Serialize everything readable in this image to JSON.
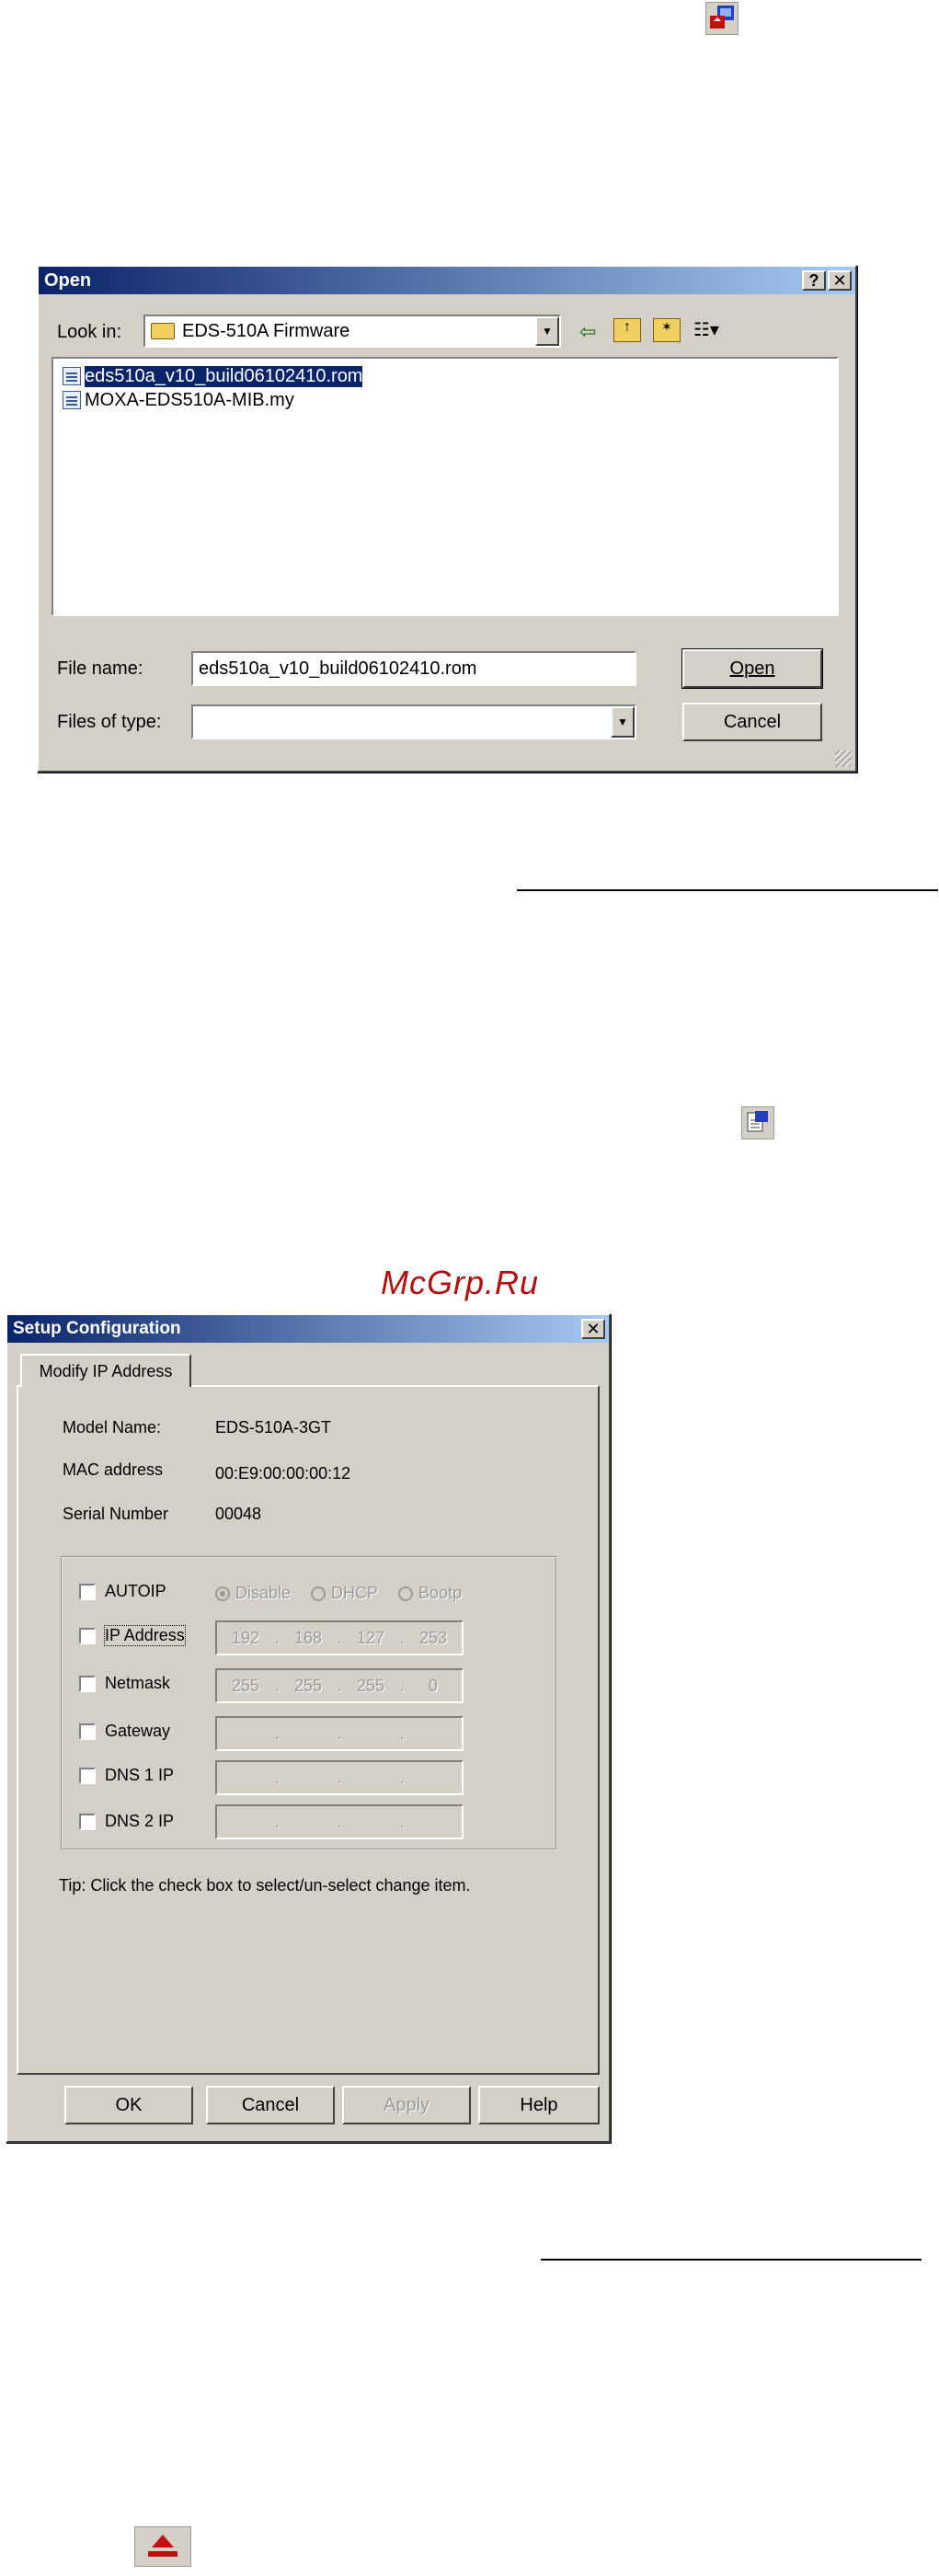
{
  "open_dialog": {
    "title": "Open",
    "help_btn": "?",
    "close_btn": "✕",
    "look_in_label": "Look in:",
    "look_in_value": "EDS-510A Firmware",
    "files": [
      {
        "name": "eds510a_v10_build06102410.rom",
        "selected": true
      },
      {
        "name": "MOXA-EDS510A-MIB.my",
        "selected": false
      }
    ],
    "file_name_label": "File name:",
    "file_name_value": "eds510a_v10_build06102410.rom",
    "files_of_type_label": "Files of type:",
    "files_of_type_value": "",
    "open_button": "Open",
    "cancel_button": "Cancel"
  },
  "watermark": "McGrp.Ru",
  "setup_dialog": {
    "title": "Setup Configuration",
    "close_btn": "✕",
    "tab_label": "Modify IP Address",
    "model_name_label": "Model Name:",
    "model_name_value": "EDS-510A-3GT",
    "mac_label": "MAC address",
    "mac_value": "00:E9:00:00:00:12",
    "serial_label": "Serial Number",
    "serial_value": "00048",
    "autoip_label": "AUTOIP",
    "radio_disable": "Disable",
    "radio_dhcp": "DHCP",
    "radio_bootp": "Bootp",
    "ip_label": "IP Address",
    "ip_octets": [
      "192",
      "168",
      "127",
      "253"
    ],
    "netmask_label": "Netmask",
    "netmask_octets": [
      "255",
      "255",
      "255",
      "0"
    ],
    "gateway_label": "Gateway",
    "dns1_label": "DNS 1 IP",
    "dns2_label": "DNS 2 IP",
    "tip": "Tip: Click the check box to select/un-select change item.",
    "ok_button": "OK",
    "cancel_button": "Cancel",
    "apply_button": "Apply",
    "help_button": "Help"
  },
  "colors": {
    "title_gradient_start": "#0a246a",
    "title_gradient_end": "#a6caf0",
    "dialog_face": "#d4d0c8",
    "watermark": "#b01010"
  }
}
